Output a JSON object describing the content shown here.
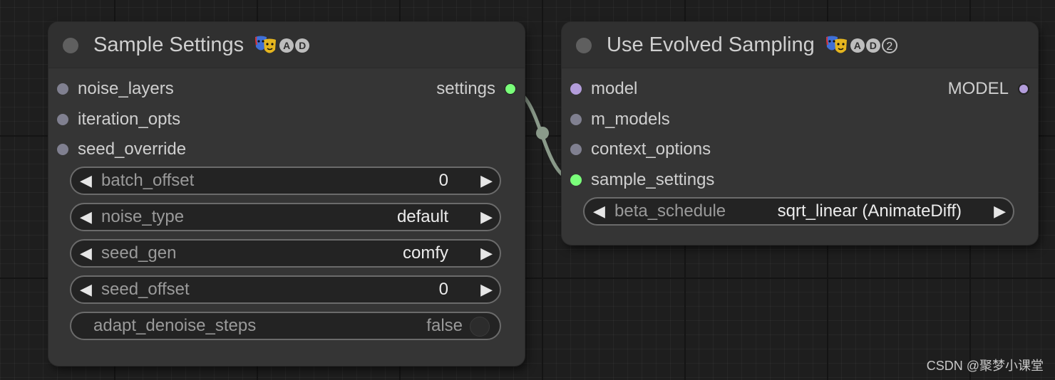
{
  "nodes": {
    "sample_settings": {
      "title": "Sample Settings",
      "badge_a": "A",
      "badge_d": "D",
      "inputs": [
        "noise_layers",
        "iteration_opts",
        "seed_override"
      ],
      "output": "settings",
      "widgets": [
        {
          "label": "batch_offset",
          "value": "0"
        },
        {
          "label": "noise_type",
          "value": "default"
        },
        {
          "label": "seed_gen",
          "value": "comfy"
        },
        {
          "label": "seed_offset",
          "value": "0"
        }
      ],
      "toggle": {
        "label": "adapt_denoise_steps",
        "value": "false"
      }
    },
    "use_evolved_sampling": {
      "title": "Use Evolved Sampling",
      "badge_a": "A",
      "badge_d": "D",
      "badge_num": "2",
      "inputs": [
        "model",
        "m_models",
        "context_options",
        "sample_settings"
      ],
      "output": "MODEL",
      "widget": {
        "label": "beta_schedule",
        "value": "sqrt_linear (AnimateDiff)"
      }
    }
  },
  "watermark": "CSDN @聚梦小课堂",
  "colors": {
    "settings_link": "#7aff7a",
    "model_slot": "#b39ddb",
    "default_slot": "#808090",
    "link_wire": "#8a9a8a"
  },
  "icons": {
    "node_badge": "theater-masks-icon",
    "left_arrow": "triangle-left",
    "right_arrow": "triangle-right"
  }
}
